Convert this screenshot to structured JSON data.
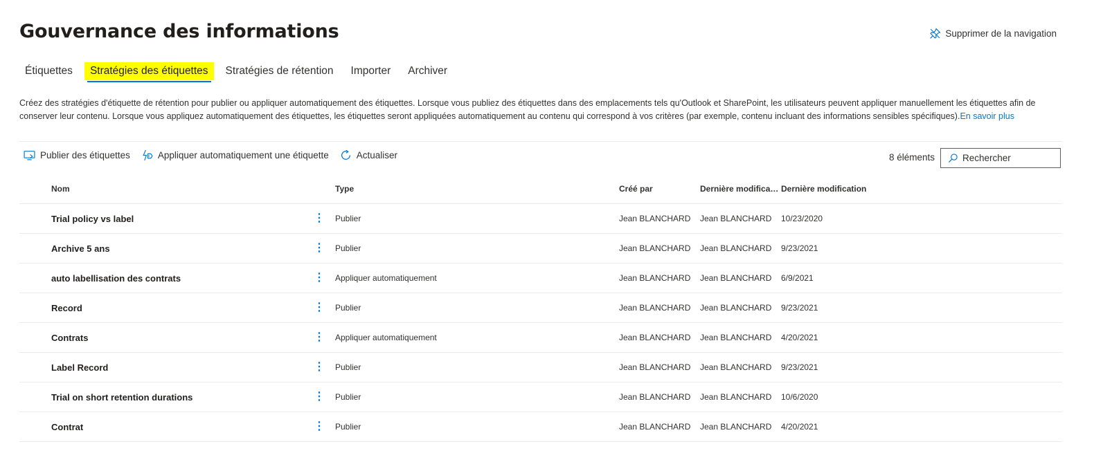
{
  "header": {
    "title": "Gouvernance des informations",
    "remove_nav_label": "Supprimer de la navigation"
  },
  "tabs": [
    {
      "label": "Étiquettes",
      "active": false
    },
    {
      "label": "Stratégies des étiquettes",
      "active": true
    },
    {
      "label": "Stratégies de rétention",
      "active": false
    },
    {
      "label": "Importer",
      "active": false
    },
    {
      "label": "Archiver",
      "active": false
    }
  ],
  "description": {
    "text": "Créez des stratégies d'étiquette de rétention pour publier ou appliquer automatiquement des étiquettes. Lorsque vous publiez des étiquettes dans des emplacements tels qu'Outlook et SharePoint, les utilisateurs peuvent appliquer manuellement les étiquettes afin de conserver leur contenu. Lorsque vous appliquez automatiquement des étiquettes, les étiquettes seront appliquées automatiquement au contenu qui correspond à vos critères (par exemple, contenu incluant des informations sensibles spécifiques).",
    "link": "En savoir plus"
  },
  "toolbar": {
    "publish_label": "Publier des étiquettes",
    "auto_apply_label": "Appliquer automatiquement une étiquette",
    "refresh_label": "Actualiser",
    "count": "8 éléments",
    "search_placeholder": "Rechercher"
  },
  "table": {
    "headers": {
      "name": "Nom",
      "type": "Type",
      "created_by": "Créé par",
      "modified_by": "Dernière modificati...",
      "modified_date": "Dernière modification"
    },
    "rows": [
      {
        "name": "Trial policy vs label",
        "type": "Publier",
        "created_by": "Jean BLANCHARD",
        "modified_by": "Jean BLANCHARD",
        "modified_date": "10/23/2020"
      },
      {
        "name": "Archive 5 ans",
        "type": "Publier",
        "created_by": "Jean BLANCHARD",
        "modified_by": "Jean BLANCHARD",
        "modified_date": "9/23/2021"
      },
      {
        "name": "auto labellisation des contrats",
        "type": "Appliquer automatiquement",
        "created_by": "Jean BLANCHARD",
        "modified_by": "Jean BLANCHARD",
        "modified_date": "6/9/2021"
      },
      {
        "name": "Record",
        "type": "Publier",
        "created_by": "Jean BLANCHARD",
        "modified_by": "Jean BLANCHARD",
        "modified_date": "9/23/2021"
      },
      {
        "name": "Contrats",
        "type": "Appliquer automatiquement",
        "created_by": "Jean BLANCHARD",
        "modified_by": "Jean BLANCHARD",
        "modified_date": "4/20/2021"
      },
      {
        "name": "Label Record",
        "type": "Publier",
        "created_by": "Jean BLANCHARD",
        "modified_by": "Jean BLANCHARD",
        "modified_date": "9/23/2021"
      },
      {
        "name": "Trial on short retention durations",
        "type": "Publier",
        "created_by": "Jean BLANCHARD",
        "modified_by": "Jean BLANCHARD",
        "modified_date": "10/6/2020"
      },
      {
        "name": "Contrat",
        "type": "Publier",
        "created_by": "Jean BLANCHARD",
        "modified_by": "Jean BLANCHARD",
        "modified_date": "4/20/2021"
      }
    ]
  },
  "colors": {
    "accent": "#0078d4",
    "highlight": "#ffff00",
    "divider": "#edebe9"
  }
}
